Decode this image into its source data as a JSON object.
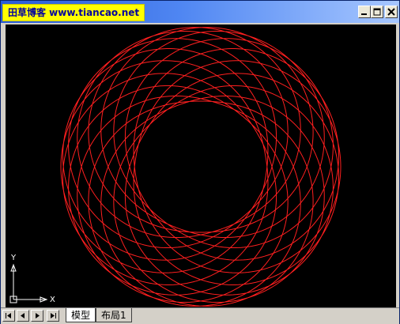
{
  "window": {
    "watermark": "田草博客 www.tiancao.net",
    "controls": {
      "minimize_icon": "minimize-icon",
      "maximize_icon": "maximize-icon",
      "close_icon": "close-icon"
    }
  },
  "drawing": {
    "background": "#000000",
    "curve_color": "#ff1f1f",
    "axis_color": "#ffffff"
  },
  "ucs": {
    "x_label": "X",
    "y_label": "Y"
  },
  "tabs": {
    "items": [
      {
        "label": "模型",
        "active": true
      },
      {
        "label": "布局1",
        "active": false
      }
    ]
  }
}
